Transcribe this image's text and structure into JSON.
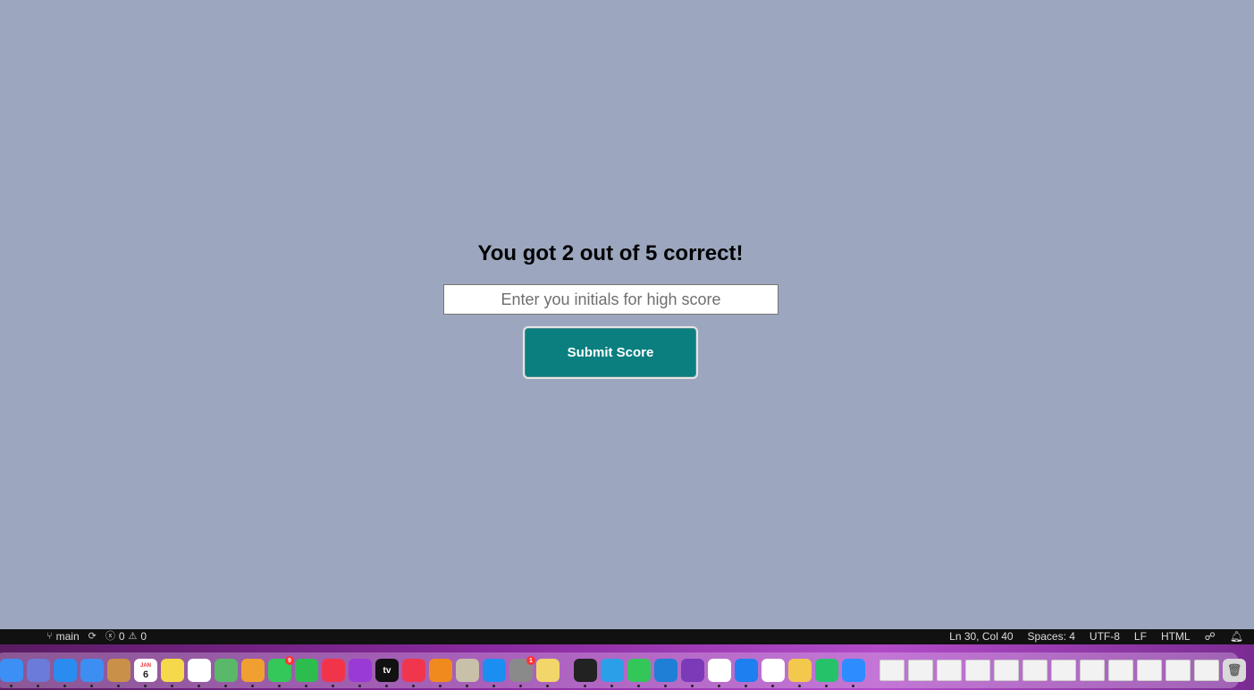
{
  "page": {
    "score_text": "You got 2 out of 5 correct!",
    "initials_placeholder": "Enter you initials for high score",
    "initials_value": "",
    "submit_label": "Submit Score"
  },
  "statusbar": {
    "branch": "main",
    "errors": "0",
    "warnings": "0",
    "position": "Ln 30, Col 40",
    "spaces": "Spaces: 4",
    "encoding": "UTF-8",
    "eol": "LF",
    "language": "HTML"
  },
  "dock": {
    "calendar_day": "6",
    "calendar_month": "JAN",
    "messages_badge": "9",
    "settings_badge": "1",
    "tv_label": "tv",
    "apps": [
      {
        "name": "finder",
        "color": "#3b8ff5"
      },
      {
        "name": "launchpad",
        "color": "#6b7bd8"
      },
      {
        "name": "safari",
        "color": "#2a8cf0"
      },
      {
        "name": "mail",
        "color": "#3d8ef2"
      },
      {
        "name": "contacts",
        "color": "#c9904a"
      },
      {
        "name": "calendar",
        "color": "#ffffff"
      },
      {
        "name": "notes",
        "color": "#f6d94a"
      },
      {
        "name": "reminders",
        "color": "#ffffff"
      },
      {
        "name": "maps",
        "color": "#59b86a"
      },
      {
        "name": "photos",
        "color": "#f0a030"
      },
      {
        "name": "messages",
        "color": "#34c759"
      },
      {
        "name": "facetime",
        "color": "#2dbd4f"
      },
      {
        "name": "music",
        "color": "#f2344b"
      },
      {
        "name": "podcasts",
        "color": "#9a3ad6"
      },
      {
        "name": "tv",
        "color": "#111111"
      },
      {
        "name": "news",
        "color": "#f0364c"
      },
      {
        "name": "books",
        "color": "#f08a1e"
      },
      {
        "name": "pencil",
        "color": "#c8c0a8"
      },
      {
        "name": "app-store",
        "color": "#1b8ef2"
      },
      {
        "name": "system-settings",
        "color": "#8a8a8a"
      },
      {
        "name": "stickies",
        "color": "#f2d66a"
      }
    ],
    "apps2": [
      {
        "name": "terminal",
        "color": "#222222"
      },
      {
        "name": "screen-sharing",
        "color": "#2ba0e8"
      },
      {
        "name": "find-my",
        "color": "#33c759"
      },
      {
        "name": "vscode",
        "color": "#1f7fd6"
      },
      {
        "name": "github-desktop",
        "color": "#7b3ab8"
      },
      {
        "name": "slack",
        "color": "#ffffff"
      },
      {
        "name": "bluetooth",
        "color": "#1e7ff0"
      },
      {
        "name": "chrome",
        "color": "#ffffff"
      },
      {
        "name": "xcode-tools",
        "color": "#f2c94c"
      },
      {
        "name": "chrome-app",
        "color": "#25c26a"
      },
      {
        "name": "zoom",
        "color": "#2d8cff"
      }
    ]
  }
}
